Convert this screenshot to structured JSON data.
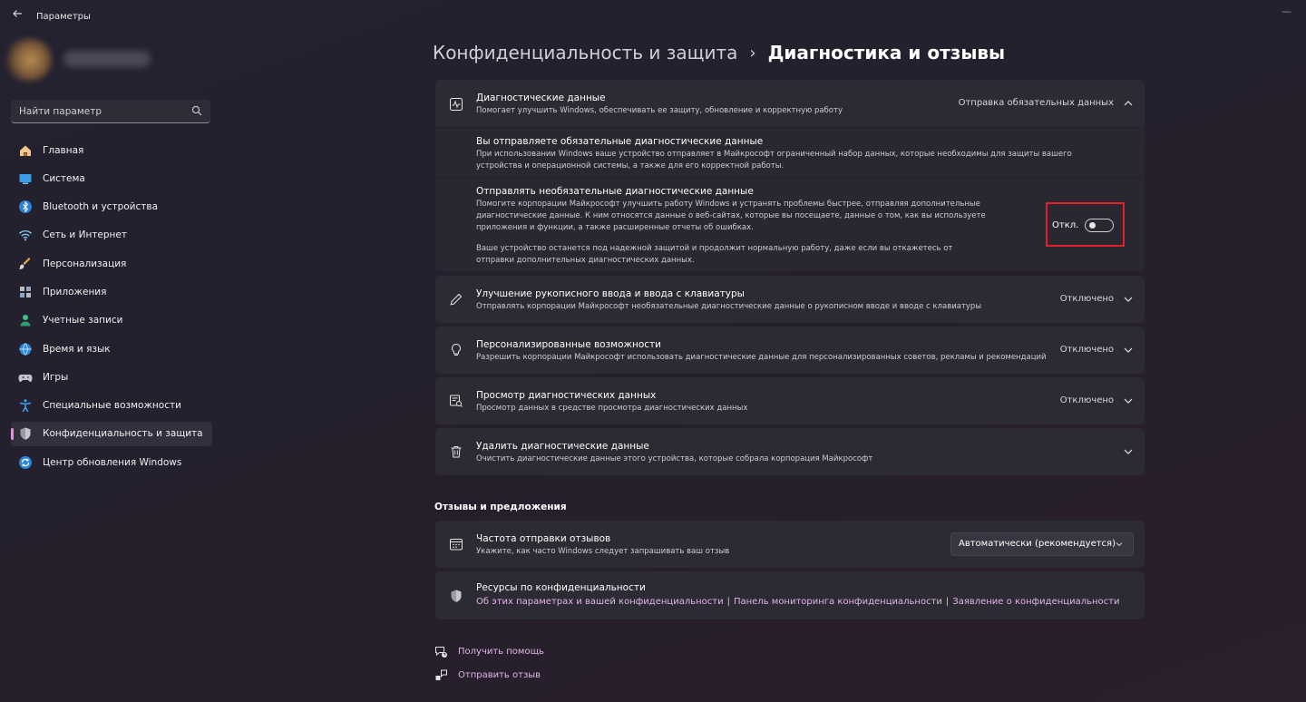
{
  "app": {
    "title": "Параметры"
  },
  "search": {
    "placeholder": "Найти параметр"
  },
  "sidebar": {
    "items": [
      {
        "label": "Главная",
        "icon": "home-icon"
      },
      {
        "label": "Система",
        "icon": "system-icon"
      },
      {
        "label": "Bluetooth и устройства",
        "icon": "bluetooth-icon"
      },
      {
        "label": "Сеть и Интернет",
        "icon": "network-icon"
      },
      {
        "label": "Персонализация",
        "icon": "brush-icon"
      },
      {
        "label": "Приложения",
        "icon": "apps-icon"
      },
      {
        "label": "Учетные записи",
        "icon": "accounts-icon"
      },
      {
        "label": "Время и язык",
        "icon": "globe-icon"
      },
      {
        "label": "Игры",
        "icon": "gamepad-icon"
      },
      {
        "label": "Специальные возможности",
        "icon": "accessibility-icon"
      },
      {
        "label": "Конфиденциальность и защита",
        "icon": "shield-icon",
        "active": true
      },
      {
        "label": "Центр обновления Windows",
        "icon": "update-icon"
      }
    ]
  },
  "breadcrumb": {
    "parent": "Конфиденциальность и защита",
    "separator": "›",
    "current": "Диагностика и отзывы"
  },
  "diagnostic": {
    "title": "Диагностические данные",
    "desc": "Помогает улучшить Windows, обеспечивать ее защиту, обновление и корректную работу",
    "value": "Отправка обязательных данных",
    "required": {
      "title": "Вы отправляете обязательные диагностические данные",
      "text": "При использовании Windows ваше устройство отправляет в Майкрософт ограниченный набор данных, которые необходимы для защиты вашего устройства и операционной системы, а также для его корректной работы."
    },
    "optional": {
      "title": "Отправлять необязательные диагностические данные",
      "text": "Помогите корпорации Майкрософт улучшить работу Windows и устранять проблемы быстрее, отправляя дополнительные диагностические данные. К ним относятся данные о веб-сайтах, которые вы посещаете, данные о том, как вы используете приложения и функции, а также расширенные отчеты об ошибках.",
      "note": "Ваше устройство останется под надежной защитой и продолжит нормальную работу, даже если вы откажетесь от отправки дополнительных диагностических данных.",
      "toggle_label": "Откл.",
      "toggle_on": false
    }
  },
  "settings": [
    {
      "title": "Улучшение рукописного ввода и ввода с клавиатуры",
      "desc": "Отправлять корпорации Майкрософт необязательные диагностические данные о рукописном вводе и вводе с клавиатуры",
      "value": "Отключено",
      "icon": "pen-icon"
    },
    {
      "title": "Персонализированные возможности",
      "desc": "Разрешить корпорации Майкрософт использовать диагностические данные для персонализированных советов, рекламы и рекомендаций",
      "value": "Отключено",
      "icon": "lightbulb-icon"
    },
    {
      "title": "Просмотр диагностических данных",
      "desc": "Просмотр данных в средстве просмотра диагностических данных",
      "value": "Отключено",
      "icon": "data-viewer-icon"
    },
    {
      "title": "Удалить диагностические данные",
      "desc": "Очистить диагностические данные этого устройства, которые собрала корпорация Майкрософт",
      "value": "",
      "icon": "trash-icon"
    }
  ],
  "feedback": {
    "section_title": "Отзывы и предложения",
    "frequency": {
      "title": "Частота отправки отзывов",
      "desc": "Укажите, как часто Windows следует запрашивать ваш отзыв",
      "value": "Автоматически (рекомендуется)"
    },
    "resources": {
      "title": "Ресурсы по конфиденциальности",
      "links": [
        "Об этих параметрах и вашей конфиденциальности",
        "Панель мониторинга конфиденциальности",
        "Заявление о конфиденциальности"
      ],
      "separator": "|"
    }
  },
  "footer": {
    "help": "Получить помощь",
    "send_feedback": "Отправить отзыв"
  },
  "colors": {
    "accent": "#d59bd4",
    "link": "#e0b6ea",
    "highlight": "#e0202a"
  }
}
